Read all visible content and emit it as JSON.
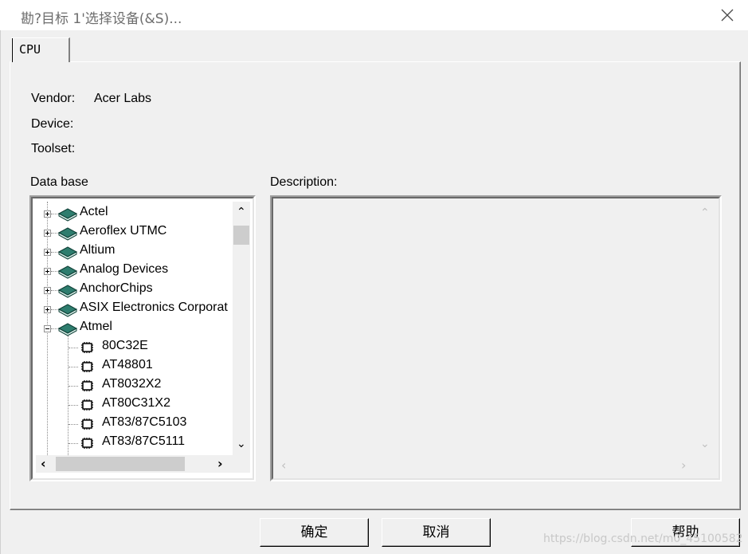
{
  "window": {
    "title": "勘?目标 1'选择设备(&S)..."
  },
  "tabs": [
    {
      "label": "CPU"
    }
  ],
  "fields": {
    "vendor_label": "Vendor:",
    "vendor_value": "Acer Labs",
    "device_label": "Device:",
    "device_value": "",
    "toolset_label": "Toolset:",
    "toolset_value": ""
  },
  "database": {
    "label": "Data base",
    "vendors": [
      "Actel",
      "Aeroflex UTMC",
      "Altium",
      "Analog Devices",
      "AnchorChips",
      "ASIX Electronics Corporat",
      "Atmel"
    ],
    "atmel_devices": [
      "80C32E",
      "AT48801",
      "AT8032X2",
      "AT80C31X2",
      "AT83/87C5103",
      "AT83/87C5111"
    ]
  },
  "description": {
    "label": "Description:",
    "text": ""
  },
  "buttons": {
    "ok": "确定",
    "cancel": "取消",
    "help": "帮助"
  },
  "watermark": "https://blog.csdn.net/m0_45100582",
  "colors": {
    "book_icon": "#2e7d6e",
    "window_bg": "#f0f0f0"
  }
}
